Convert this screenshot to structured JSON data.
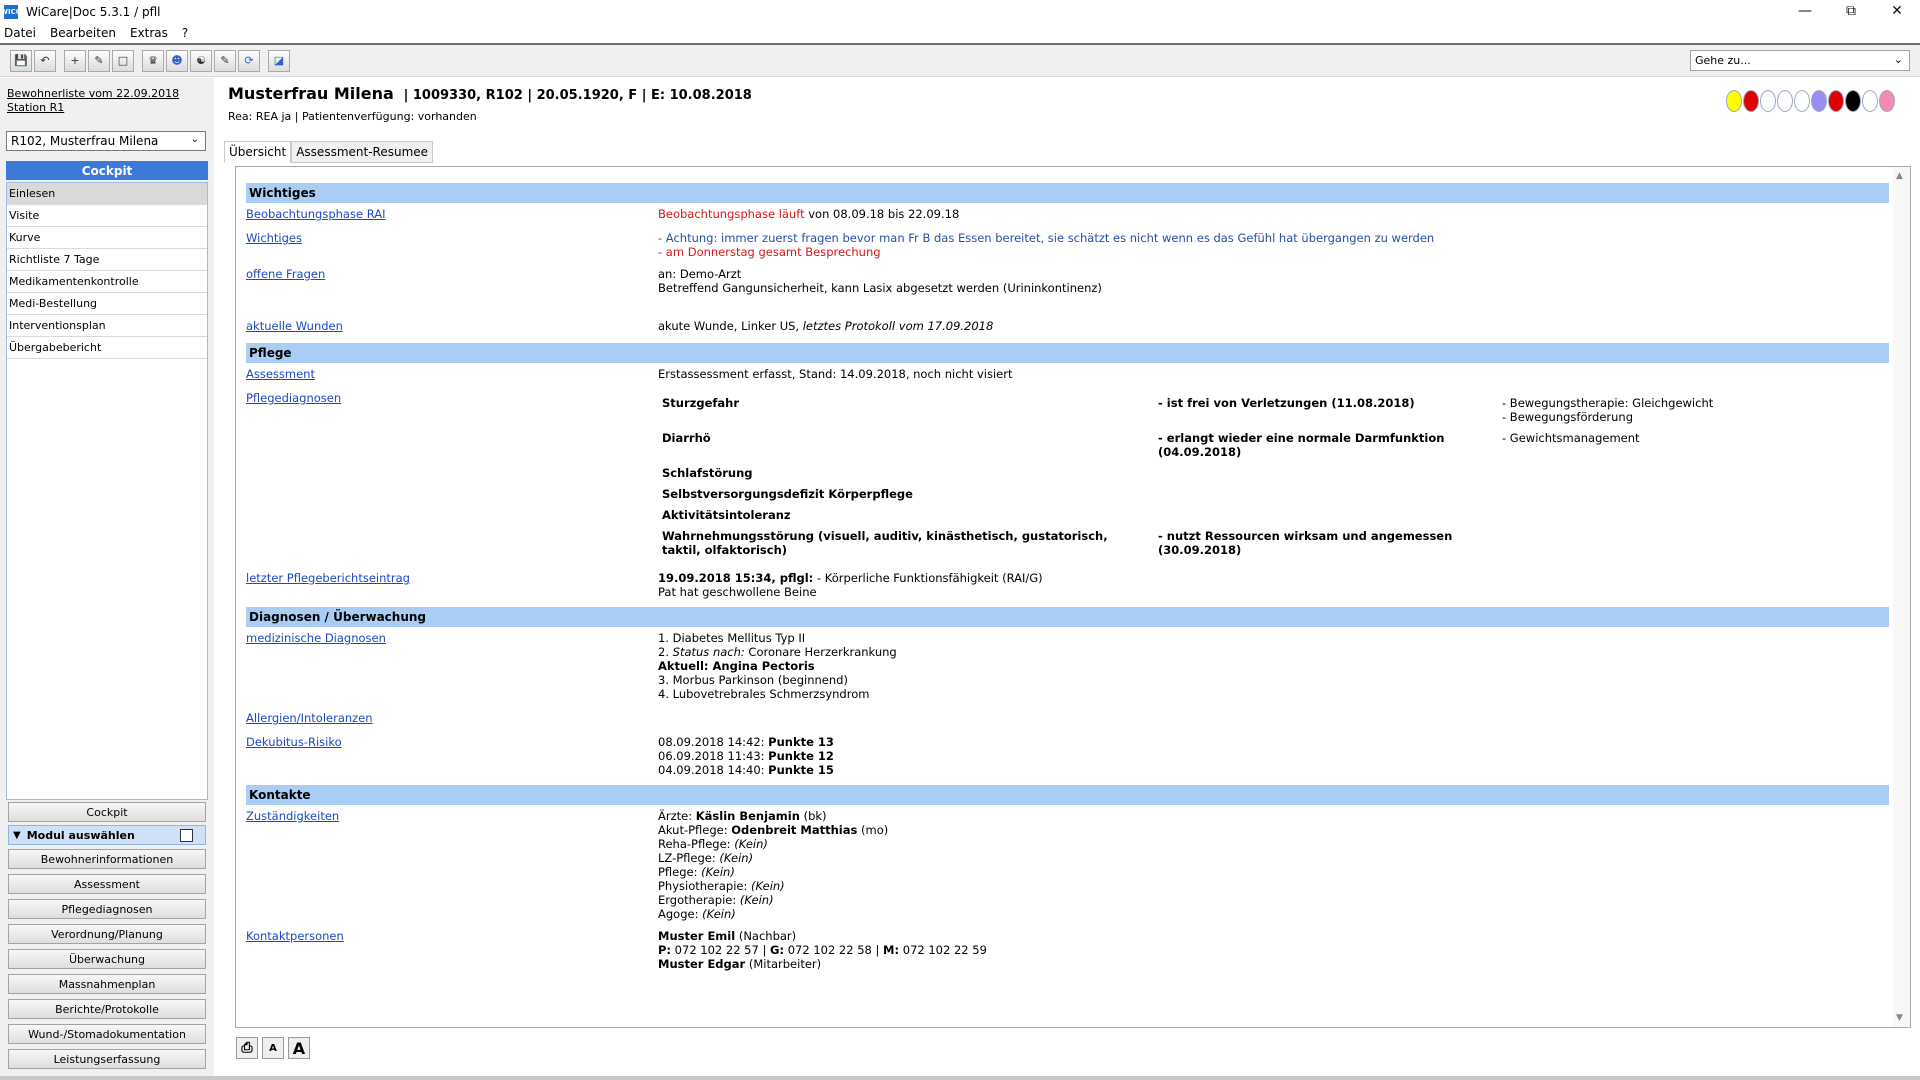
{
  "window": {
    "title": "WiCare|Doc 5.3.1  / pfll",
    "icon_text": "WICO"
  },
  "menu": [
    "Datei",
    "Bearbeiten",
    "Extras",
    "?"
  ],
  "toolbar": {
    "goto_placeholder": "Gehe zu..."
  },
  "left": {
    "resident_list_link": "Bewohnerliste vom 22.09.2018",
    "station_link": "Station R1",
    "resident_select": "R102, Musterfrau Milena",
    "cockpit_header": "Cockpit",
    "nav_items": [
      "Einlesen",
      "Visite",
      "Kurve",
      "Richtliste 7 Tage",
      "Medikamentenkontrolle",
      "Medi-Bestellung",
      "Interventionsplan",
      "Übergabebericht"
    ],
    "cockpit_button": "Cockpit",
    "modul_label": "Modul auswählen",
    "modules": [
      "Bewohnerinformationen",
      "Assessment",
      "Pflegediagnosen",
      "Verordnung/Planung",
      "Überwachung",
      "Massnahmenplan",
      "Berichte/Protokolle",
      "Wund-/Stomadokumentation",
      "Leistungserfassung"
    ]
  },
  "header": {
    "patient_name": "Musterfrau Milena",
    "patient_info": "| 1009330, R102 | 20.05.1920, F | E: 10.08.2018",
    "sub": "Rea: REA ja | Patientenverfügung: vorhanden",
    "status_dot_colors": [
      "#ffff00",
      "#e00000",
      "#ffffff",
      "#ffffff",
      "#ffffff",
      "#9b8cf0",
      "#e00000",
      "#000000",
      "#ffffff",
      "#f58ab0"
    ]
  },
  "tabs": [
    "Übersicht",
    "Assessment-Resumee"
  ],
  "sections": {
    "wichtiges": {
      "title": "Wichtiges",
      "beobachtung_label": "Beobachtungsphase RAI",
      "beobachtung_red": "Beobachtungsphase läuft",
      "beobachtung_rest": " von 08.09.18 bis 22.09.18",
      "wichtiges_label": "Wichtiges",
      "wichtiges_line1": "- Achtung: immer zuerst fragen bevor man Fr B das Essen bereitet, sie schätzt es nicht wenn es das Gefühl hat übergangen zu werden",
      "wichtiges_line2": "- am Donnerstag gesamt Besprechung",
      "fragen_label": "offene Fragen",
      "fragen_line1": "an: Demo-Arzt",
      "fragen_line2": "Betreffend Gangunsicherheit, kann Lasix abgesetzt werden (Urininkontinenz)",
      "wunden_label": "aktuelle Wunden",
      "wunden_text": "akute Wunde, Linker US, ",
      "wunden_italic": "letztes Protokoll vom 17.09.2018"
    },
    "pflege": {
      "title": "Pflege",
      "assessment_label": "Assessment",
      "assessment_text": "Erstassessment erfasst, Stand: 14.09.2018, noch nicht visiert",
      "diagnosen_label": "Pflegediagnosen",
      "diagnoses": [
        {
          "diagnosis": "Sturzgefahr",
          "goal": "- ist frei von Verletzungen (11.08.2018)",
          "measures": "- Bewegungstherapie: Gleichgewicht\n- Bewegungsförderung"
        },
        {
          "diagnosis": "Diarrhö",
          "goal": "- erlangt wieder eine normale Darmfunktion (04.09.2018)",
          "measures": "- Gewichtsmanagement"
        },
        {
          "diagnosis": "Schlafstörung",
          "goal": "",
          "measures": ""
        },
        {
          "diagnosis": "Selbstversorgungsdefizit Körperpflege",
          "goal": "",
          "measures": ""
        },
        {
          "diagnosis": "Aktivitätsintoleranz",
          "goal": "",
          "measures": ""
        },
        {
          "diagnosis": "Wahrnehmungsstörung (visuell, auditiv, kinästhetisch, gustatorisch, taktil, olfaktorisch)",
          "goal": "- nutzt Ressourcen wirksam und angemessen (30.09.2018)",
          "measures": ""
        }
      ],
      "bericht_label": "letzter Pflegeberichtseintrag",
      "bericht_bold": "19.09.2018 15:34, pflgl:",
      "bericht_rest": " - Körperliche Funktionsfähigkeit (RAI/G)",
      "bericht_line2": "Pat hat geschwollene Beine"
    },
    "diagnosen": {
      "title": "Diagnosen / Überwachung",
      "med_label": "medizinische Diagnosen",
      "med_line1": "1. Diabetes Mellitus Typ II",
      "med_line2_prefix": "2. ",
      "med_line2_italic": "Status nach:",
      "med_line2_rest": " Coronare Herzerkrankung",
      "med_line3": "Aktuell: Angina Pectoris",
      "med_line4": "3. Morbus Parkinson (beginnend)",
      "med_line5": "4. Lubovetrebrales Schmerzsyndrom",
      "allergien_label": "Allergien/Intoleranzen",
      "dekubitus_label": "Dekubitus-Risiko",
      "dekubitus": [
        {
          "date": "08.09.2018 14:42: ",
          "points": "Punkte 13"
        },
        {
          "date": "06.09.2018 11:43: ",
          "points": "Punkte 12"
        },
        {
          "date": "04.09.2018 14:40: ",
          "points": "Punkte 15"
        }
      ]
    },
    "kontakte": {
      "title": "Kontakte",
      "zust_label": "Zuständigkeiten",
      "aerzte_prefix": "Ärzte: ",
      "aerzte_name": "Käslin Benjamin",
      "aerzte_suffix": " (bk)",
      "akut_prefix": "Akut-Pflege: ",
      "akut_name": "Odenbreit Matthias",
      "akut_suffix": " (mo)",
      "roles": [
        {
          "role": "Reha-Pflege: ",
          "value": "(Kein)"
        },
        {
          "role": "LZ-Pflege: ",
          "value": "(Kein)"
        },
        {
          "role": "Pflege: ",
          "value": "(Kein)"
        },
        {
          "role": "Physiotherapie: ",
          "value": "(Kein)"
        },
        {
          "role": "Ergotherapie: ",
          "value": "(Kein)"
        },
        {
          "role": "Agoge: ",
          "value": "(Kein)"
        }
      ],
      "kontakt_label": "Kontaktpersonen",
      "person1_name": "Muster Emil",
      "person1_rel": " (Nachbar)",
      "phone_p_label": "P:",
      "phone_p": " 072 102 22 57 | ",
      "phone_g_label": "G:",
      "phone_g": " 072 102 22 58 | ",
      "phone_m_label": "M:",
      "phone_m": " 072 102 22 59",
      "person2_name": "Muster Edgar",
      "person2_rel": " (Mitarbeiter)"
    }
  },
  "bottom": {
    "font_small": "A",
    "font_large": "A"
  }
}
